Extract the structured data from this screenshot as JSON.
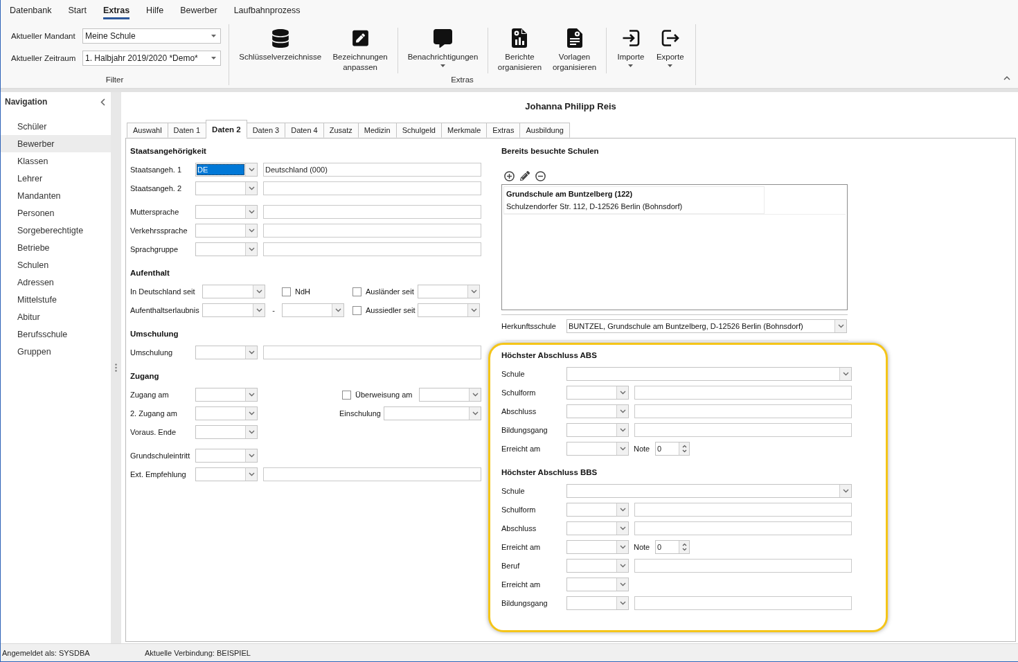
{
  "menu": [
    {
      "label": "Datenbank",
      "selected": false
    },
    {
      "label": "Start",
      "selected": false
    },
    {
      "label": "Extras",
      "selected": true
    },
    {
      "label": "Hilfe",
      "selected": false
    },
    {
      "label": "Bewerber",
      "selected": false
    },
    {
      "label": "Laufbahnprozess",
      "selected": false
    }
  ],
  "ribbon": {
    "filter": {
      "label": "Filter",
      "fields": [
        {
          "label": "Aktueller Mandant",
          "value": "Meine Schule"
        },
        {
          "label": "Aktueller Zeitraum",
          "value": "1. Halbjahr 2019/2020 *Demo*"
        }
      ]
    },
    "extras": {
      "label": "Extras",
      "clusters": [
        {
          "buttons": [
            {
              "label": "Schlüsselverzeichnisse",
              "dropdown": false
            },
            {
              "label": "Bezeichnungen anpassen",
              "dropdown": false
            }
          ]
        },
        {
          "buttons": [
            {
              "label": "Benachrichtigungen",
              "dropdown": true
            }
          ]
        },
        {
          "buttons": [
            {
              "label": "Berichte organisieren",
              "dropdown": false
            },
            {
              "label": "Vorlagen organisieren",
              "dropdown": false
            }
          ]
        },
        {
          "buttons": [
            {
              "label": "Importe",
              "dropdown": true
            },
            {
              "label": "Exporte",
              "dropdown": true
            }
          ]
        }
      ]
    }
  },
  "navigation": {
    "title": "Navigation",
    "items": [
      {
        "label": "Schüler",
        "selected": false
      },
      {
        "label": "Bewerber",
        "selected": true
      },
      {
        "label": "Klassen",
        "selected": false
      },
      {
        "label": "Lehrer",
        "selected": false
      },
      {
        "label": "Mandanten",
        "selected": false
      },
      {
        "label": "Personen",
        "selected": false
      },
      {
        "label": "Sorgeberechtigte",
        "selected": false
      },
      {
        "label": "Betriebe",
        "selected": false
      },
      {
        "label": "Schulen",
        "selected": false
      },
      {
        "label": "Adressen",
        "selected": false
      },
      {
        "label": "Mittelstufe",
        "selected": false
      },
      {
        "label": "Abitur",
        "selected": false
      },
      {
        "label": "Berufsschule",
        "selected": false
      },
      {
        "label": "Gruppen",
        "selected": false
      }
    ]
  },
  "record": {
    "title": "Johanna Philipp Reis",
    "tabs": [
      {
        "label": "Auswahl",
        "selected": false
      },
      {
        "label": "Daten 1",
        "selected": false
      },
      {
        "label": "Daten 2",
        "selected": true
      },
      {
        "label": "Daten 3",
        "selected": false
      },
      {
        "label": "Daten 4",
        "selected": false
      },
      {
        "label": "Zusatz",
        "selected": false
      },
      {
        "label": "Medizin",
        "selected": false
      },
      {
        "label": "Schulgeld",
        "selected": false
      },
      {
        "label": "Merkmale",
        "selected": false
      },
      {
        "label": "Extras",
        "selected": false
      },
      {
        "label": "Ausbildung",
        "selected": false
      }
    ],
    "left_sections": [
      {
        "title": "Staatsangehörigkeit",
        "groups": [
          {
            "rows": [
              {
                "kind": "pair",
                "controls": [
                  {
                    "kind": "label",
                    "text": "Staatsangeh. 1"
                  },
                  {
                    "kind": "combo",
                    "value": "DE",
                    "focused": true
                  },
                  {
                    "kind": "text",
                    "value": "Deutschland (000)"
                  }
                ]
              },
              {
                "kind": "pair",
                "controls": [
                  {
                    "kind": "label",
                    "text": "Staatsangeh. 2"
                  },
                  {
                    "kind": "combo",
                    "focused": false
                  },
                  {
                    "kind": "text"
                  }
                ]
              }
            ]
          },
          {
            "rows": [
              {
                "kind": "pair",
                "controls": [
                  {
                    "kind": "label",
                    "text": "Muttersprache"
                  },
                  {
                    "kind": "combo",
                    "focused": false
                  },
                  {
                    "kind": "text"
                  }
                ]
              },
              {
                "kind": "pair",
                "controls": [
                  {
                    "kind": "label",
                    "text": "Verkehrssprache"
                  },
                  {
                    "kind": "combo",
                    "focused": false
                  },
                  {
                    "kind": "text"
                  }
                ]
              },
              {
                "kind": "pair",
                "controls": [
                  {
                    "kind": "label",
                    "text": "Sprachgruppe"
                  },
                  {
                    "kind": "combo",
                    "focused": false
                  },
                  {
                    "kind": "text"
                  }
                ]
              }
            ]
          }
        ]
      },
      {
        "title": "Aufenthalt",
        "groups": [
          {
            "rows": [
              {
                "kind": "residence",
                "controls": [
                  {
                    "kind": "label",
                    "text": "In Deutschland seit"
                  },
                  {
                    "kind": "combo",
                    "focused": false
                  },
                  {
                    "kind": "checkbox",
                    "label": "NdH",
                    "checked": false
                  },
                  {
                    "kind": "checkbox",
                    "label": "Ausländer seit",
                    "checked": false
                  },
                  {
                    "kind": "combo",
                    "focused": false
                  }
                ]
              },
              {
                "kind": "permit",
                "controls": [
                  {
                    "kind": "label",
                    "text": "Aufenthaltserlaubnis"
                  },
                  {
                    "kind": "combo",
                    "focused": false
                  },
                  {
                    "kind": "dash",
                    "text": "-"
                  },
                  {
                    "kind": "combo",
                    "focused": false
                  },
                  {
                    "kind": "checkbox",
                    "label": "Aussiedler seit",
                    "checked": false
                  },
                  {
                    "kind": "combo",
                    "focused": false
                  }
                ]
              }
            ]
          }
        ]
      },
      {
        "title": "Umschulung",
        "groups": [
          {
            "rows": [
              {
                "kind": "pair",
                "controls": [
                  {
                    "kind": "label",
                    "text": "Umschulung"
                  },
                  {
                    "kind": "combo",
                    "focused": false
                  },
                  {
                    "kind": "text"
                  }
                ]
              }
            ]
          }
        ]
      },
      {
        "title": "Zugang",
        "groups": [
          {
            "rows": [
              {
                "kind": "transfer",
                "controls": [
                  {
                    "kind": "label",
                    "text": "Zugang am"
                  },
                  {
                    "kind": "combo",
                    "focused": false
                  },
                  {
                    "kind": "checkbox",
                    "label": "Überweisung am",
                    "checked": false
                  },
                  {
                    "kind": "combo",
                    "focused": false
                  }
                ]
              },
              {
                "kind": "enrolment",
                "controls": [
                  {
                    "kind": "label",
                    "text": "2. Zugang am"
                  },
                  {
                    "kind": "combo",
                    "focused": false
                  },
                  {
                    "kind": "label",
                    "text": "Einschulung"
                  },
                  {
                    "kind": "combo",
                    "focused": false
                  }
                ]
              },
              {
                "kind": "pair",
                "controls": [
                  {
                    "kind": "label",
                    "text": "Voraus. Ende"
                  },
                  {
                    "kind": "combo",
                    "focused": false
                  }
                ]
              }
            ]
          },
          {
            "rows": [
              {
                "kind": "pair",
                "controls": [
                  {
                    "kind": "label",
                    "text": "Grundschuleintritt"
                  },
                  {
                    "kind": "combo",
                    "focused": false
                  }
                ]
              },
              {
                "kind": "pair",
                "controls": [
                  {
                    "kind": "label",
                    "text": "Ext. Empfehlung"
                  },
                  {
                    "kind": "combo",
                    "focused": false
                  },
                  {
                    "kind": "text"
                  }
                ]
              }
            ]
          }
        ]
      }
    ],
    "visited_schools": {
      "title": "Bereits besuchte Schulen",
      "entries": [
        {
          "name": "Grundschule am Buntzelberg (122)",
          "address": "Schulzendorfer Str. 112, D-12526 Berlin (Bohnsdorf)"
        }
      ],
      "origin": {
        "kind": "wide",
        "controls": [
          {
            "kind": "label",
            "text": "Herkunftsschule"
          },
          {
            "kind": "combo",
            "value": "BUNTZEL, Grundschule am Buntzelberg, D-12526 Berlin (Bohnsdorf)",
            "focused": false
          }
        ]
      }
    },
    "highlight": {
      "sections": [
        {
          "title": "Höchster Abschluss ABS",
          "groups": [
            {
              "rows": [
                {
                  "kind": "wide",
                  "controls": [
                    {
                      "kind": "label",
                      "text": "Schule"
                    },
                    {
                      "kind": "combo",
                      "focused": false
                    }
                  ]
                },
                {
                  "kind": "pair",
                  "controls": [
                    {
                      "kind": "label",
                      "text": "Schulform"
                    },
                    {
                      "kind": "combo",
                      "focused": false
                    },
                    {
                      "kind": "text"
                    }
                  ]
                },
                {
                  "kind": "pair",
                  "controls": [
                    {
                      "kind": "label",
                      "text": "Abschluss"
                    },
                    {
                      "kind": "combo",
                      "focused": false
                    },
                    {
                      "kind": "text"
                    }
                  ]
                },
                {
                  "kind": "pair",
                  "controls": [
                    {
                      "kind": "label",
                      "text": "Bildungsgang"
                    },
                    {
                      "kind": "combo",
                      "focused": false
                    },
                    {
                      "kind": "text"
                    }
                  ]
                },
                {
                  "kind": "grade",
                  "controls": [
                    {
                      "kind": "label",
                      "text": "Erreicht am"
                    },
                    {
                      "kind": "combo",
                      "focused": false
                    },
                    {
                      "kind": "label",
                      "text": "Note"
                    },
                    {
                      "kind": "spin",
                      "value": "0"
                    }
                  ]
                }
              ]
            }
          ]
        },
        {
          "title": "Höchster Abschluss BBS",
          "groups": [
            {
              "rows": [
                {
                  "kind": "wide",
                  "controls": [
                    {
                      "kind": "label",
                      "text": "Schule"
                    },
                    {
                      "kind": "combo",
                      "focused": false
                    }
                  ]
                },
                {
                  "kind": "pair",
                  "controls": [
                    {
                      "kind": "label",
                      "text": "Schulform"
                    },
                    {
                      "kind": "combo",
                      "focused": false
                    },
                    {
                      "kind": "text"
                    }
                  ]
                },
                {
                  "kind": "pair",
                  "controls": [
                    {
                      "kind": "label",
                      "text": "Abschluss"
                    },
                    {
                      "kind": "combo",
                      "focused": false
                    },
                    {
                      "kind": "text"
                    }
                  ]
                },
                {
                  "kind": "grade",
                  "controls": [
                    {
                      "kind": "label",
                      "text": "Erreicht am"
                    },
                    {
                      "kind": "combo",
                      "focused": false
                    },
                    {
                      "kind": "label",
                      "text": "Note"
                    },
                    {
                      "kind": "spin",
                      "value": "0"
                    }
                  ]
                },
                {
                  "kind": "pair",
                  "controls": [
                    {
                      "kind": "label",
                      "text": "Beruf"
                    },
                    {
                      "kind": "combo",
                      "focused": false
                    },
                    {
                      "kind": "text"
                    }
                  ]
                },
                {
                  "kind": "pair",
                  "controls": [
                    {
                      "kind": "label",
                      "text": "Erreicht am"
                    },
                    {
                      "kind": "combo",
                      "focused": false
                    }
                  ]
                },
                {
                  "kind": "pair",
                  "controls": [
                    {
                      "kind": "label",
                      "text": "Bildungsgang"
                    },
                    {
                      "kind": "combo",
                      "focused": false
                    },
                    {
                      "kind": "text"
                    }
                  ]
                }
              ]
            }
          ]
        }
      ]
    }
  },
  "status_bar": {
    "user": "Angemeldet als: SYSDBA",
    "connection": "Aktuelle Verbindung: BEISPIEL"
  }
}
